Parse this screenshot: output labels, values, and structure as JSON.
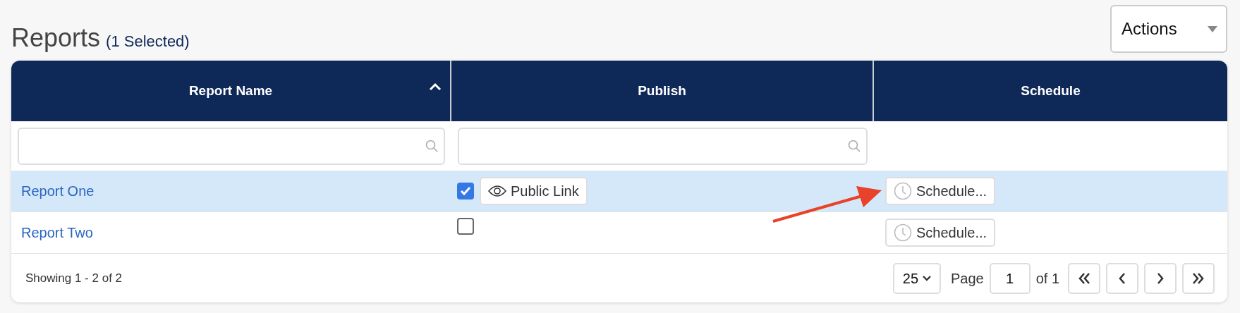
{
  "title": "Reports",
  "selection_note": "(1 Selected)",
  "actions": {
    "label": "Actions"
  },
  "columns": [
    {
      "label": "Report Name",
      "sorted": true,
      "filter": true
    },
    {
      "label": "Publish",
      "sorted": false,
      "filter": true
    },
    {
      "label": "Schedule",
      "sorted": false,
      "filter": false
    }
  ],
  "rows": [
    {
      "name": "Report One",
      "selected": true,
      "checked": true,
      "public_link": "Public Link",
      "schedule": "Schedule..."
    },
    {
      "name": "Report Two",
      "selected": false,
      "checked": false,
      "schedule": "Schedule..."
    }
  ],
  "footer": {
    "summary": "Showing 1 - 2 of 2",
    "page_size": "25",
    "page_label": "Page",
    "page": "1",
    "page_total": "of 1"
  }
}
